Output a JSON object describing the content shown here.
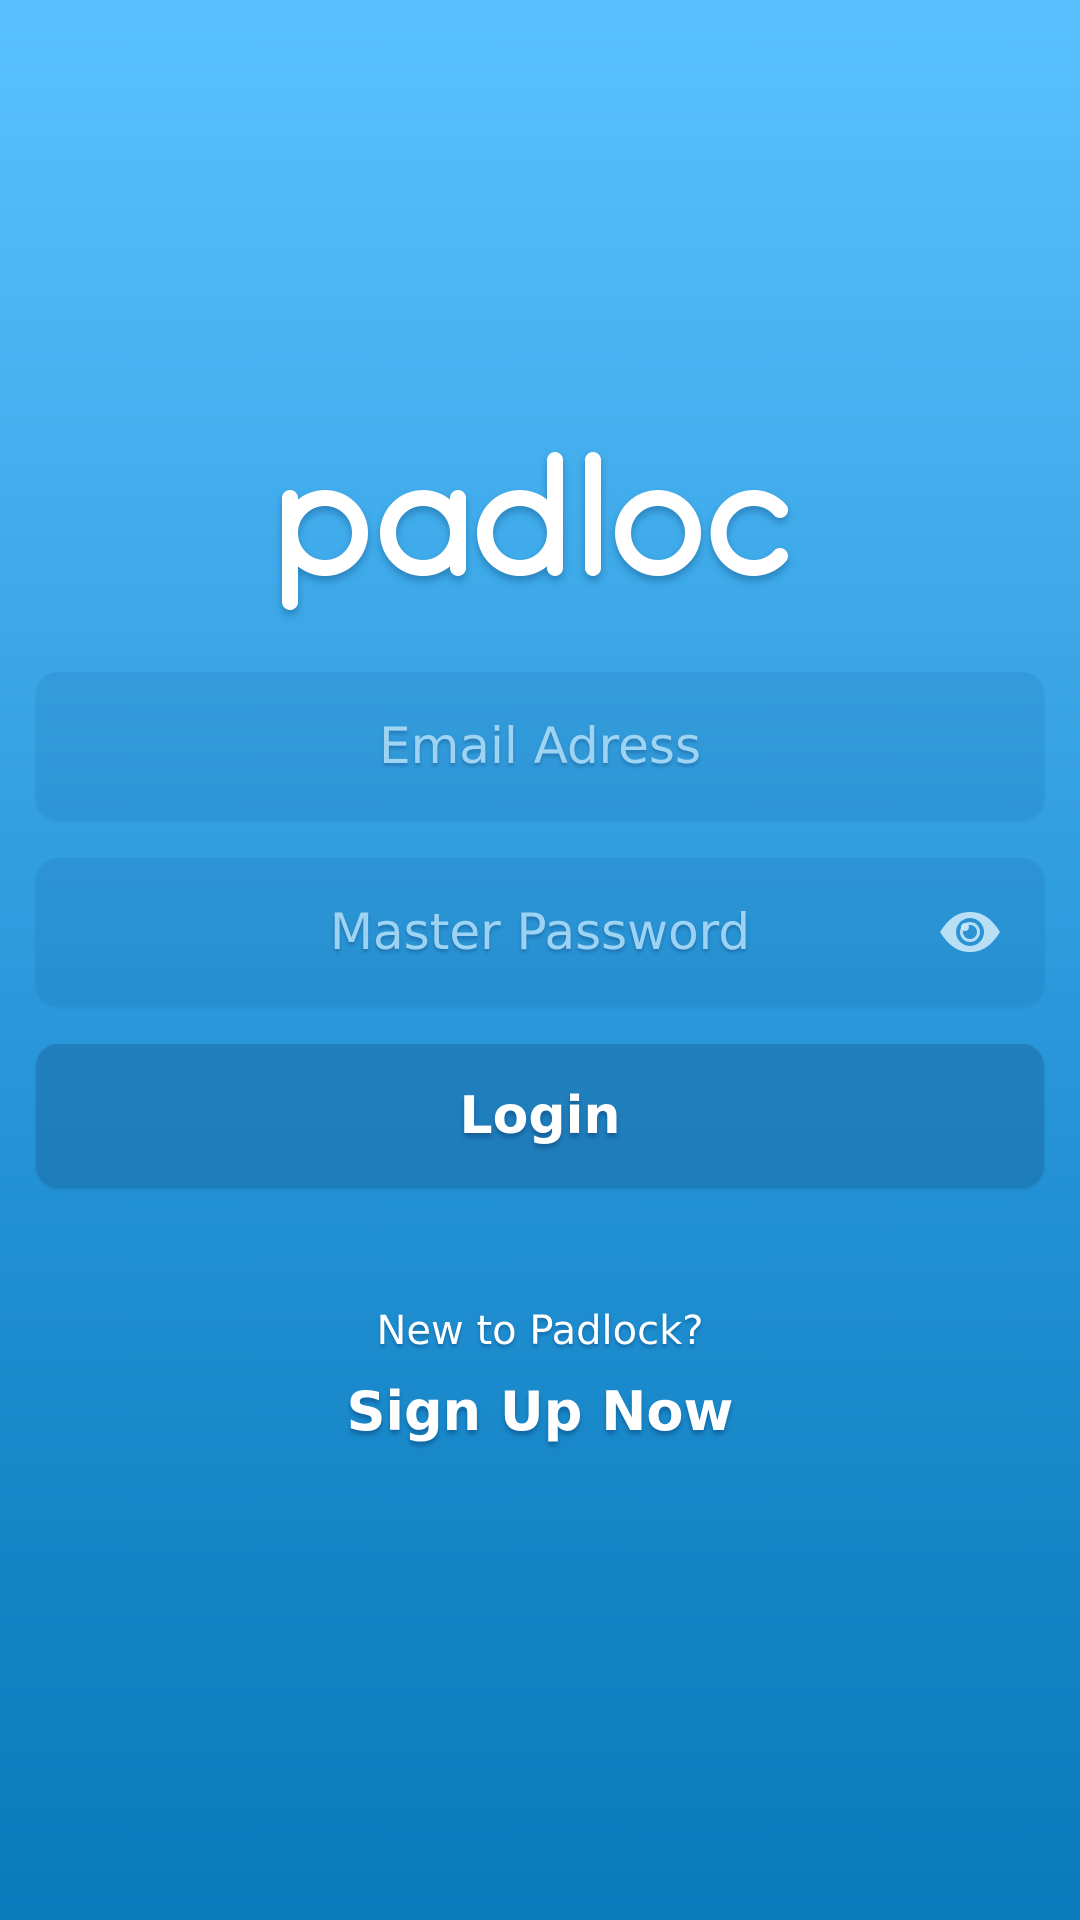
{
  "app": {
    "logo_text": "padloc"
  },
  "form": {
    "email_placeholder": "Email Adress",
    "password_placeholder": "Master Password",
    "password_visibility_icon": "eye-icon",
    "login_label": "Login"
  },
  "footer": {
    "prompt": "New to Padlock?",
    "signup_label": "Sign Up Now"
  },
  "colors": {
    "background_top": "#59c1ff",
    "background_bottom": "#0a7abb",
    "text": "#ffffff"
  }
}
